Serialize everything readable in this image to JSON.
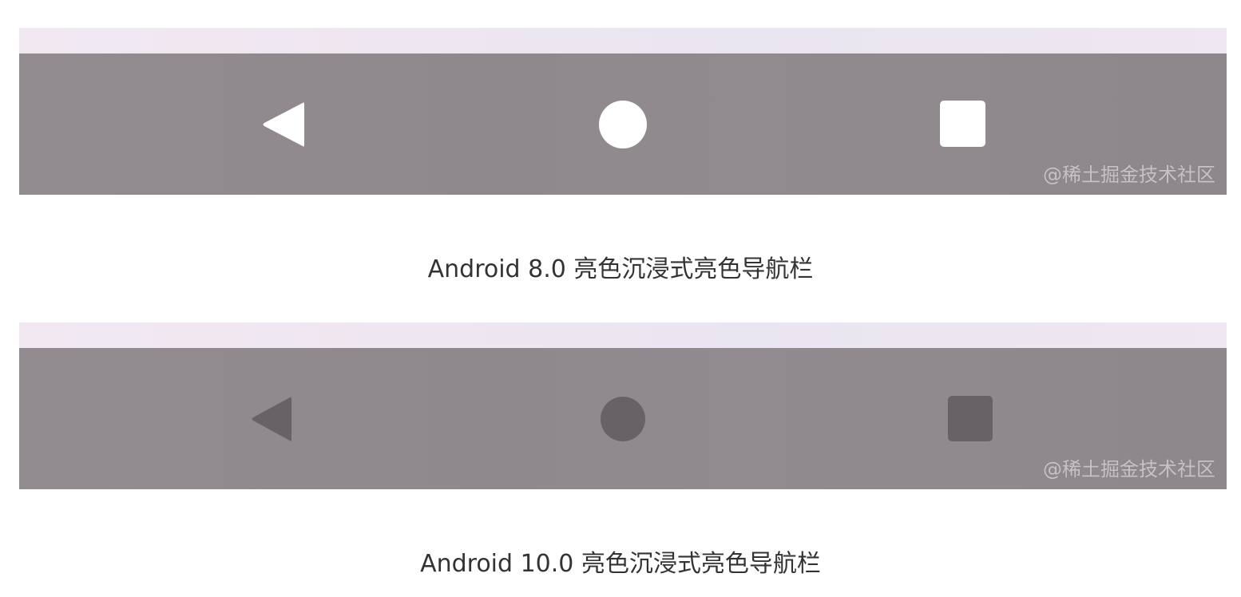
{
  "figures": [
    {
      "caption": "Android 8.0 亮色沉浸式亮色导航栏",
      "watermark": "@稀土掘金技术社区",
      "icons": {
        "back": "back-triangle-icon",
        "home": "home-circle-icon",
        "recents": "recents-square-icon"
      },
      "icon_color": "#ffffff"
    },
    {
      "caption": "Android 10.0 亮色沉浸式亮色导航栏",
      "watermark": "@稀土掘金技术社区",
      "icons": {
        "back": "back-triangle-icon",
        "home": "home-circle-icon",
        "recents": "recents-square-icon"
      },
      "icon_color": "#676265"
    }
  ],
  "colors": {
    "status_bar": "#eee6f0",
    "nav_bar": "#908a8e",
    "caption_text": "#333333",
    "background": "#ffffff"
  }
}
